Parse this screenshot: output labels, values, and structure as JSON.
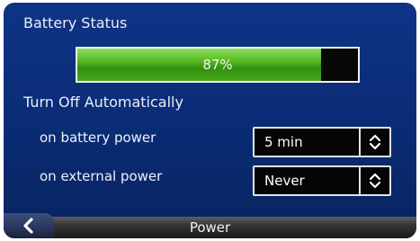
{
  "battery": {
    "title": "Battery Status",
    "level_percent": 87,
    "level_text": "87%"
  },
  "auto_off": {
    "title": "Turn Off Automatically",
    "rows": [
      {
        "label": "on battery power",
        "value": "5 min"
      },
      {
        "label": "on external power",
        "value": "Never"
      }
    ]
  },
  "bottom": {
    "title": "Power",
    "back_icon": "chevron-left-icon"
  },
  "icons": {
    "stepper": "up-down-chevron-icon"
  },
  "colors": {
    "background": "#0b2d78",
    "battery_fill": "#4caf1f"
  }
}
